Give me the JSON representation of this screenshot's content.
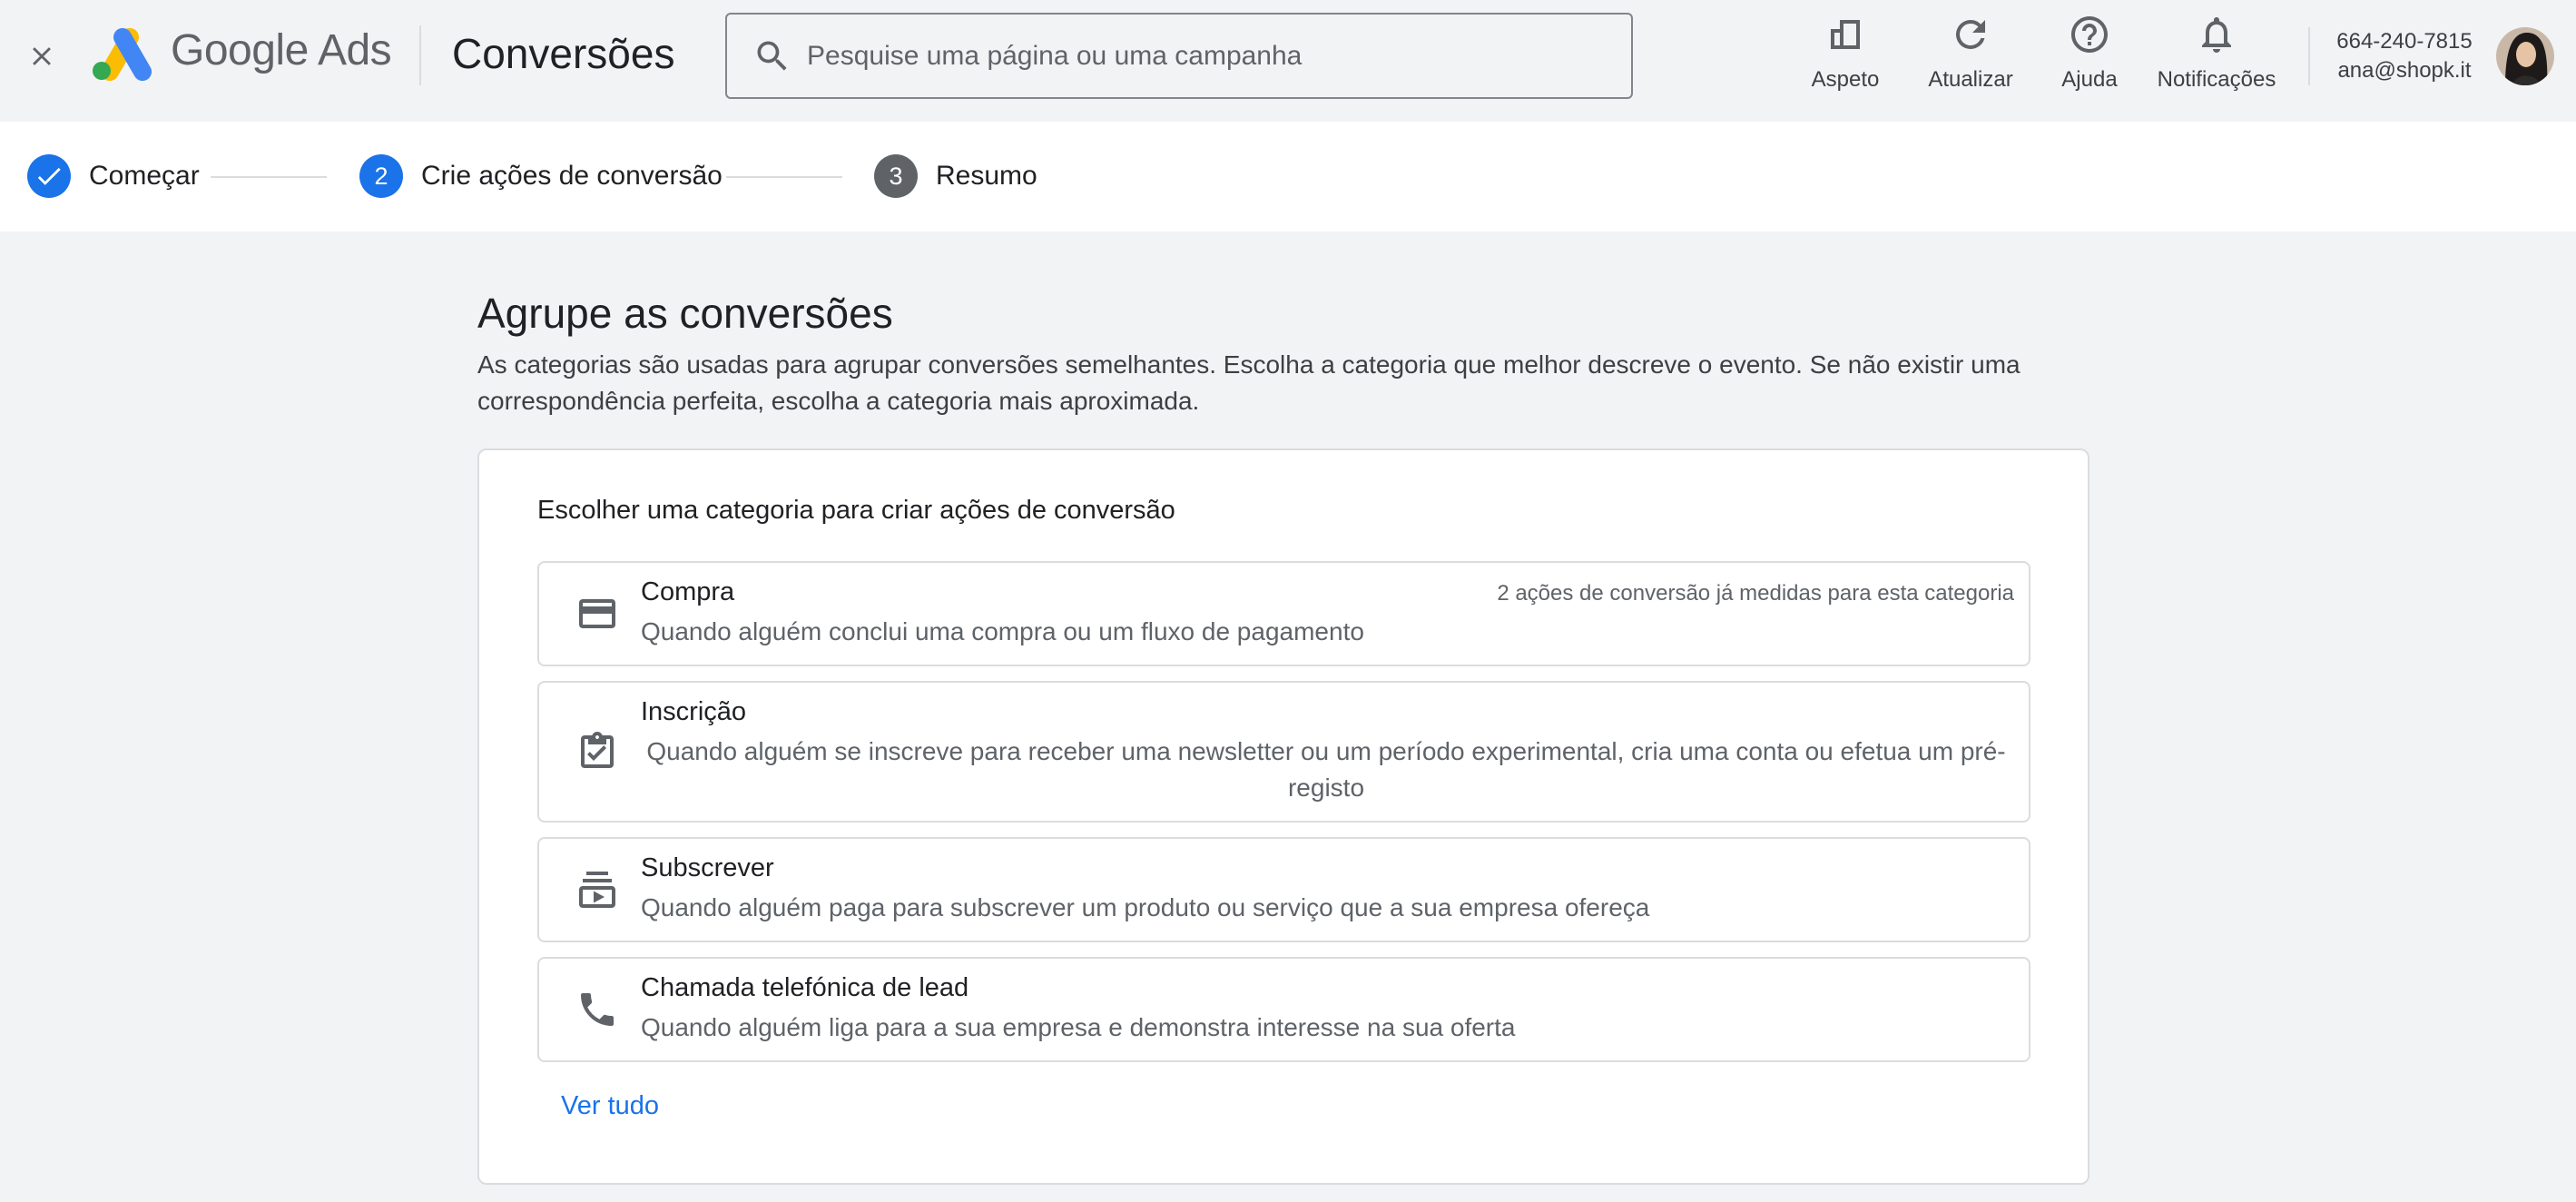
{
  "header": {
    "close_label": "Close",
    "brand_google": "Google",
    "brand_ads": "Ads",
    "page_title": "Conversões",
    "search": {
      "placeholder": "Pesquise uma página ou uma campanha",
      "value": ""
    },
    "tools": [
      {
        "label": "Aspeto",
        "icon": "appearance-icon"
      },
      {
        "label": "Atualizar",
        "icon": "refresh-icon"
      },
      {
        "label": "Ajuda",
        "icon": "help-icon"
      },
      {
        "label": "Notificações",
        "icon": "bell-icon"
      }
    ],
    "account": {
      "phone": "664-240-7815",
      "email": "ana@shopk.it"
    }
  },
  "stepper": {
    "steps": [
      {
        "number": "",
        "label": "Começar",
        "state": "completed"
      },
      {
        "number": "2",
        "label": "Crie ações de conversão",
        "state": "current"
      },
      {
        "number": "3",
        "label": "Resumo",
        "state": "upcoming"
      }
    ]
  },
  "main": {
    "heading": "Agrupe as conversões",
    "description": "As categorias são usadas para agrupar conversões semelhantes. Escolha a categoria que melhor descreve o evento. Se não existir uma correspondência perfeita, escolha a categoria mais aproximada.",
    "card": {
      "title": "Escolher uma categoria para criar ações de conversão",
      "options": [
        {
          "title": "Compra",
          "description": "Quando alguém conclui uma compra ou um fluxo de pagamento",
          "note": "2 ações de conversão já medidas para esta categoria",
          "icon": "credit-card-icon"
        },
        {
          "title": "Inscrição",
          "description": "Quando alguém se inscreve para receber uma newsletter ou um período experimental, cria uma conta ou efetua um pré-registo",
          "icon": "clipboard-check-icon"
        },
        {
          "title": "Subscrever",
          "description": "Quando alguém paga para subscrever um produto ou serviço que a sua empresa ofereça",
          "icon": "subscriptions-icon"
        },
        {
          "title": "Chamada telefónica de lead",
          "description": "Quando alguém liga para a sua empresa e demonstra interesse na sua oferta",
          "icon": "phone-icon"
        }
      ],
      "see_all": "Ver tudo"
    }
  },
  "colors": {
    "accent_blue": "#1a73e8",
    "step_complete": "#1a73e8",
    "step_current": "#1a73e8",
    "step_upcoming": "#5f6368",
    "page_bg": "#f1f3f4",
    "logo_blue": "#4285f4",
    "logo_yellow": "#fbbc04",
    "logo_green": "#34a853"
  }
}
